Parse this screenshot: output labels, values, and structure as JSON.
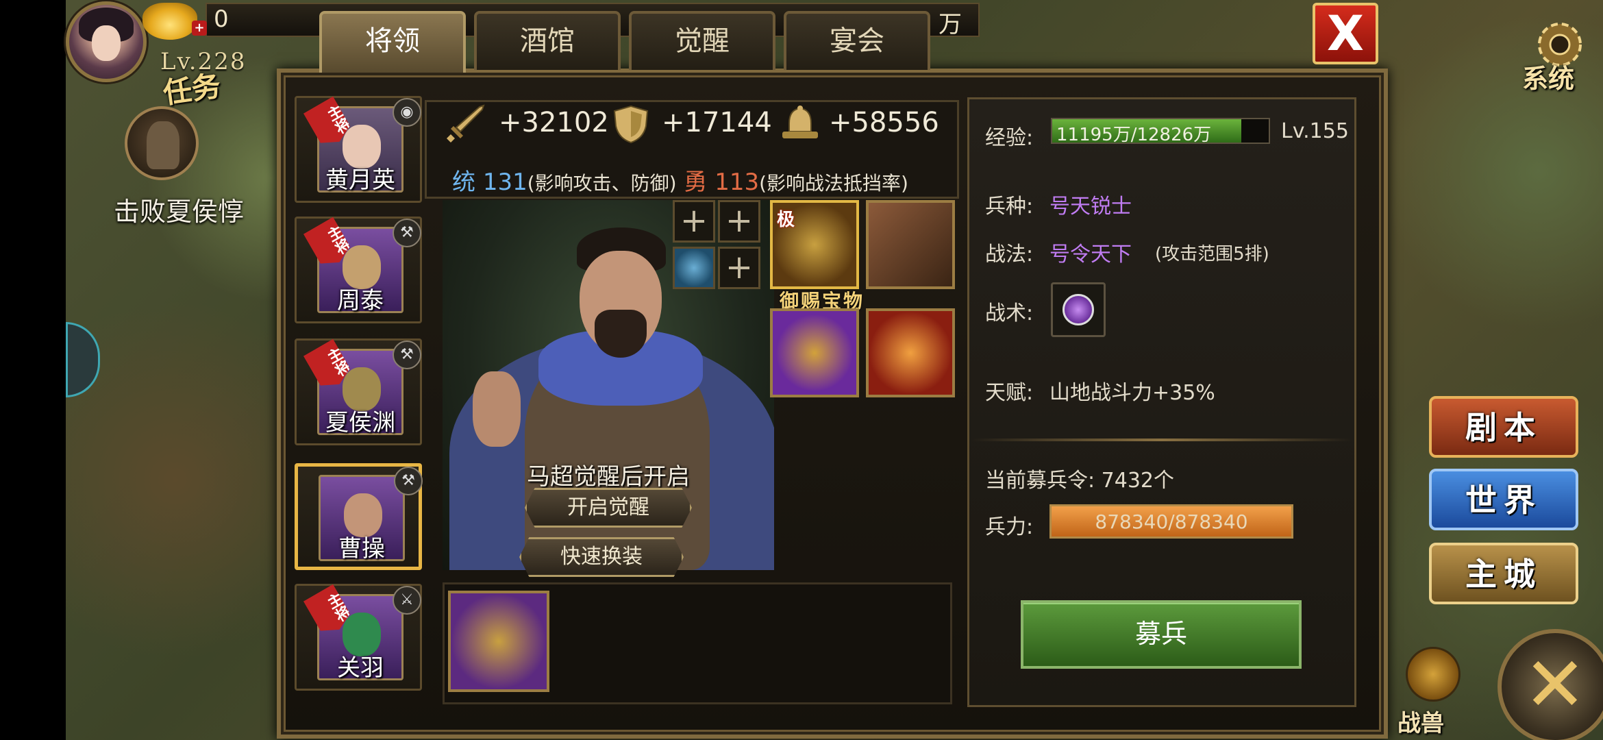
{
  "hud": {
    "gold": "0",
    "resource_unit": "万",
    "level": "Lv.228",
    "task_label": "任务",
    "task_desc": "击败夏侯惇"
  },
  "tabs": [
    "将领",
    "酒馆",
    "觉醒",
    "宴会"
  ],
  "close_glyph": "X",
  "heroes": [
    {
      "name": "黄月英",
      "tag": "主将",
      "selected": false
    },
    {
      "name": "周泰",
      "tag": "主将",
      "selected": false
    },
    {
      "name": "夏侯渊",
      "tag": "主将",
      "selected": false
    },
    {
      "name": "曹操",
      "tag": "",
      "selected": true
    },
    {
      "name": "关羽",
      "tag": "主将",
      "selected": false
    }
  ],
  "stats": {
    "attack": "+32102",
    "defense": "+17144",
    "hp": "+58556",
    "tong_label": "统",
    "tong_value": "131",
    "tong_note": "(影响攻击、防御)",
    "yong_label": "勇",
    "yong_value": "113",
    "yong_note": "(影响战法抵挡率)"
  },
  "portrait": {
    "awaken_note": "马超觉醒后开启",
    "awaken_button": "开启觉醒",
    "quick_equip_button": "快速换装"
  },
  "equipment": {
    "plus_glyph": "+",
    "treasure_label": "御赐宝物",
    "ji_badge": "极"
  },
  "info": {
    "exp_label": "经验:",
    "exp_value": "11195万/12826万",
    "exp_fraction": 0.873,
    "level": "Lv.155",
    "troop_type_label": "兵种:",
    "troop_type": "号天锐士",
    "tactic_label": "战法:",
    "tactic": "号令天下",
    "tactic_note": "(攻击范围5排)",
    "art_label": "战术:",
    "talent_label": "天赋:",
    "talent": "山地战斗力+35%",
    "recruit_tokens": "当前募兵令: 7432个",
    "troops_label": "兵力:",
    "troops_value": "878340/878340",
    "troops_fraction": 1.0,
    "recruit_button": "募兵"
  },
  "side": {
    "system_label": "系统",
    "script_button": "剧本",
    "world_button": "世界",
    "city_button": "主城",
    "beast_label": "战兽",
    "close_round_glyph": "✕"
  },
  "colors": {
    "purple_text": "#c07cf2",
    "tong_blue": "#6fb5ee",
    "yong_red": "#e36c45",
    "exp_green": "#6bb33c",
    "troop_orange": "#f2a04a"
  }
}
